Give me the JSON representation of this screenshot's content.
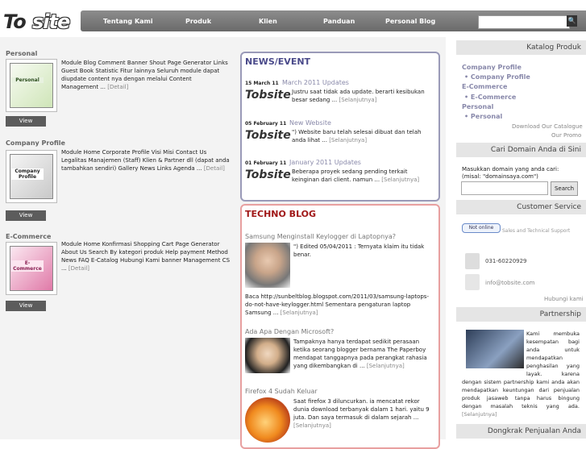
{
  "header": {
    "logo_left": "To",
    "logo_right": "site",
    "nav": [
      "Tentang Kami",
      "Produk",
      "Klien",
      "Panduan",
      "Personal Blog"
    ],
    "search_placeholder": ""
  },
  "products": [
    {
      "title": "Personal",
      "box_label": "Personal",
      "description": "Module Blog Comment Banner Shout Page Generator Links Guest Book Statistic Fitur lainnya Seluruh module dapat diupdate content nya dengan melalui Content Management ...",
      "more": "[Detail]",
      "button": "View"
    },
    {
      "title": "Company Profile",
      "box_label": "Company Profile",
      "description": "Module Home Corporate Profile Visi Misi Contact Us Legalitas Manajemen (Staff) Klien & Partner dll (dapat anda tambahkan sendiri) Gallery News Links Agenda ...",
      "more": "[Detail]",
      "button": "View"
    },
    {
      "title": "E-Commerce",
      "box_label": "E-Commerce",
      "description": "Module Home Konfirmasi Shopping Cart Page Generator About Us Search By kategori produk Help payment Method News FAQ E-Catalog Hubungi Kami banner Management CS ...",
      "more": "[Detail]",
      "button": "View"
    }
  ],
  "news": {
    "title": "NEWS/EVENT",
    "items": [
      {
        "date": "15 March 11",
        "headline": "March 2011 Updates",
        "text": "Justru saat tidak ada update. berarti kesibukan besar sedang ...",
        "more": "[Selanjutnya]"
      },
      {
        "date": "05 February 11",
        "headline": "New Website",
        "text": "\") Website baru telah selesai dibuat dan telah anda lihat ...",
        "more": "[Selanjutnya]"
      },
      {
        "date": "01 February 11",
        "headline": "January 2011 Updates",
        "text": "Beberapa proyek sedang pending terkait keinginan dari client. namun ...",
        "more": "[Selanjutnya]"
      }
    ]
  },
  "blog": {
    "title": "TECHNO BLOG",
    "items": [
      {
        "headline": "Samsung Menginstall Keylogger di Laptopnya?",
        "text": "\") Edited 05/04/2011 : Ternyata klaim itu tidak benar.",
        "extra": "Baca http://sunbeltblog.blogspot.com/2011/03/samsung-laptops-do-not-have-keylogger.html   Sementara pengaturan laptop Samsung ...",
        "more": "[Selanjutnya]"
      },
      {
        "headline": "Ada Apa Dengan Microsoft?",
        "text": "Tampaknya hanya terdapat sedikit perasaan ketika seorang blogger bernama The Paperboy mendapat tanggapnya pada perangkat rahasia yang dikembangkan di ...",
        "more": "[Selanjutnya]"
      },
      {
        "headline": "Firefox 4 Sudah Keluar",
        "text": "Saat firefox 3 diluncurkan. ia mencatat rekor dunia download terbanyak dalam 1 hari. yaitu 9 juta. Dan saya termasuk di dalam sejarah ...",
        "more": "[Selanjutnya]"
      }
    ]
  },
  "sidebar": {
    "catalog_title": "Katalog Produk",
    "catalog": [
      {
        "type": "cat",
        "label": "Company Profile"
      },
      {
        "type": "item",
        "label": "Company Profile"
      },
      {
        "type": "cat",
        "label": "E-Commerce"
      },
      {
        "type": "item",
        "label": "E-Commerce"
      },
      {
        "type": "cat",
        "label": "Personal"
      },
      {
        "type": "item",
        "label": "Personal"
      }
    ],
    "download": "Download Our Catalogue",
    "promo": "Our Promo",
    "domain_title": "Cari Domain Anda di Sini",
    "domain_text": "Masukkan domain yang anda cari:",
    "domain_hint": "(misal: \"domainsaya.com\")",
    "domain_button": "Search",
    "service_title": "Customer Service",
    "status": "Not online",
    "status_label": "Sales and Technical Support",
    "phone": "031-60220929",
    "email": "info@tobsite.com",
    "contact_link": "Hubungi kami",
    "partner_title": "Partnership",
    "partner_text": "Kami membuka kesempatan bagi anda untuk mendapatkan penghasilan yang layak. karena dengan sistem partnership kami anda akan mendapatkan keuntungan dari penjualan produk jasaweb tanpa harus bingung dengan masalah teknis yang ada.",
    "partner_more": "[Selanjutnya]",
    "sales_title": "Dongkrak Penjualan Anda"
  }
}
